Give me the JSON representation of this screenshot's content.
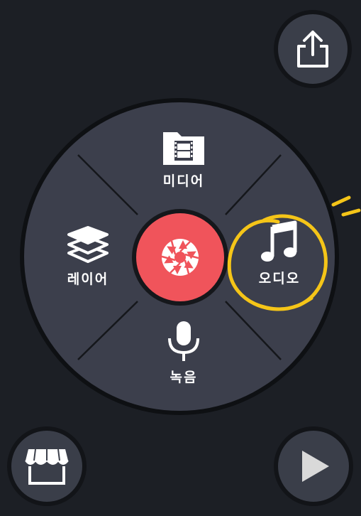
{
  "wheel": {
    "media_label": "미디어",
    "layer_label": "레이어",
    "audio_label": "오디오",
    "record_label": "녹음"
  },
  "colors": {
    "background": "#1c1f25",
    "wheel": "#3c3f4c",
    "capture": "#f0545b",
    "highlight": "#f5c518",
    "icon": "#ffffff"
  },
  "icons": {
    "share": "share-icon",
    "store": "store-icon",
    "play": "play-icon",
    "media": "media-folder-icon",
    "layer": "layers-icon",
    "audio": "music-note-icon",
    "record": "microphone-icon",
    "capture": "camera-aperture-icon"
  }
}
